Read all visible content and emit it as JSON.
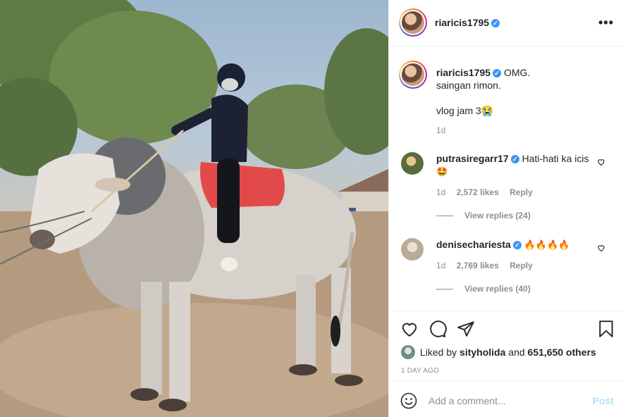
{
  "post": {
    "photo_description_icon": "cow-photo"
  },
  "header": {
    "username": "riaricis1795",
    "verified_icon": "verified-badge-icon",
    "more_icon": "more-options-icon"
  },
  "caption": {
    "username": "riaricis1795",
    "line1": "OMG.",
    "line2": "saingan rimon.",
    "line3": "vlog jam 3😭",
    "time": "1d"
  },
  "comments": [
    {
      "username": "putrasiregarr17",
      "text": "Hati-hati ka icis",
      "emoji": "🤩",
      "time": "1d",
      "likes": "2,572 likes",
      "reply": "Reply",
      "view_replies": "View replies (24)"
    },
    {
      "username": "denisechariesta",
      "text": "",
      "emoji": "🔥🔥🔥🔥",
      "time": "1d",
      "likes": "2,769 likes",
      "reply": "Reply",
      "view_replies": "View replies (40)"
    }
  ],
  "actions": {
    "liked_by_prefix": "Liked by",
    "liked_by_user": "sityholida",
    "liked_by_and": "and",
    "liked_by_others": "651,650 others",
    "post_age": "1 DAY AGO"
  },
  "add_comment": {
    "placeholder": "Add a comment...",
    "post_label": "Post"
  },
  "colors": {
    "verified": "#3897f0",
    "post_button_disabled": "#b2dffc",
    "muted_text": "#8e8e8e",
    "primary_text": "#262626"
  }
}
